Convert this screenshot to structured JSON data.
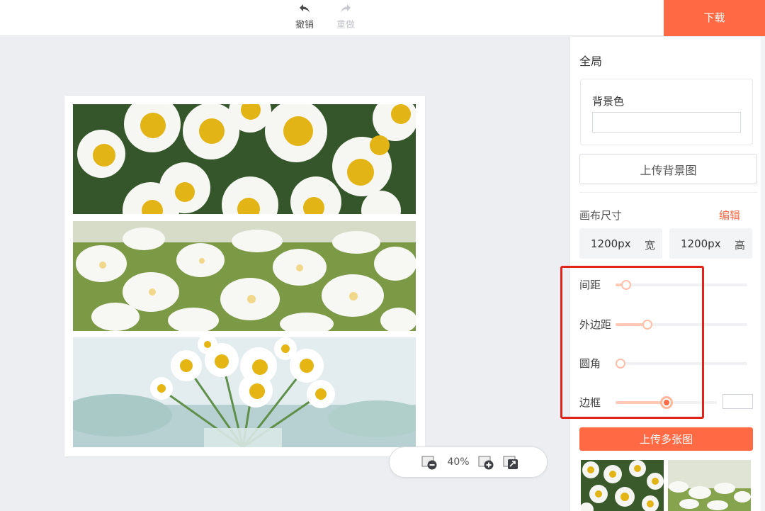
{
  "toolbar": {
    "undo_label": "撤销",
    "redo_label": "重做",
    "download_label": "下载"
  },
  "zoom": {
    "level": "40%"
  },
  "panel": {
    "title": "全局",
    "background_color_label": "背景色",
    "upload_background_label": "上传背景图",
    "canvas_size_label": "画布尺寸",
    "edit_label": "编辑",
    "width_value": "1200px",
    "width_unit": "宽",
    "height_value": "1200px",
    "height_unit": "高",
    "sliders": [
      {
        "label": "间距",
        "value": 0.08
      },
      {
        "label": "外边距",
        "value": 0.24
      },
      {
        "label": "圆角",
        "value": 0.0
      },
      {
        "label": "边框",
        "value": 0.5
      }
    ],
    "upload_multiple_label": "上传多张图"
  },
  "colors": {
    "accent": "#ff6a45",
    "highlight_box": "#e0231b"
  }
}
